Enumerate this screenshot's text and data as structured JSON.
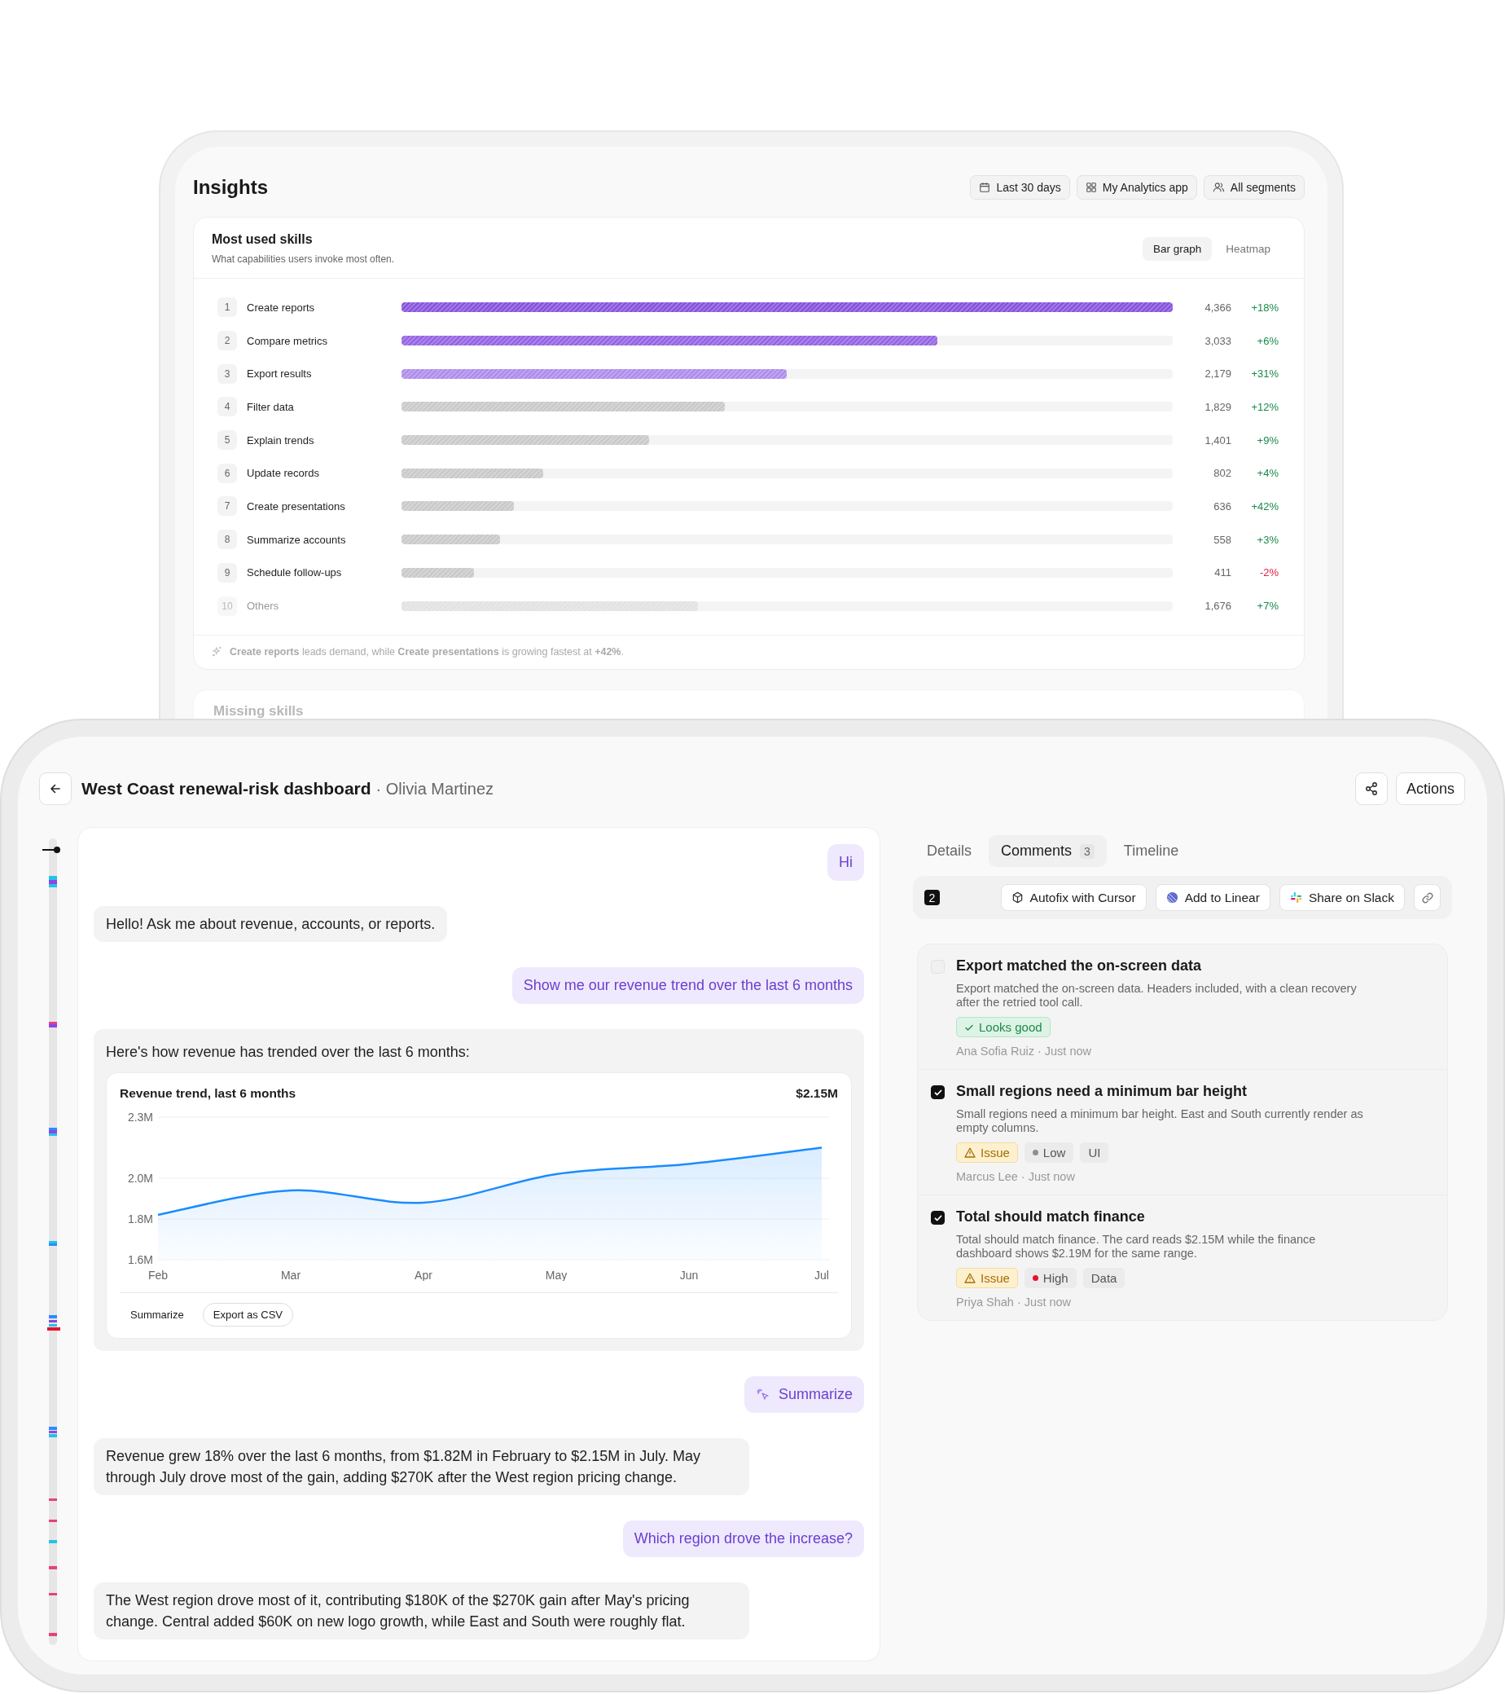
{
  "insights": {
    "title": "Insights",
    "filters": [
      {
        "kind": "date",
        "label": "Last 30 days"
      },
      {
        "kind": "app",
        "label": "My Analytics app"
      },
      {
        "kind": "segment",
        "label": "All segments"
      }
    ],
    "skills_card": {
      "title": "Most used skills",
      "subtitle": "What capabilities users invoke most often.",
      "views": [
        {
          "label": "Bar graph",
          "selected": true
        },
        {
          "label": "Heatmap",
          "selected": false
        }
      ],
      "rows": [
        {
          "rank": "1",
          "label": "Create reports",
          "level": 1.0,
          "color": "#8652dc",
          "count": "4,366",
          "change": {
            "text": "+18%",
            "color": "#1b8a4a"
          },
          "muted": false
        },
        {
          "rank": "2",
          "label": "Compare metrics",
          "level": 0.695,
          "color": "#9462e3",
          "count": "3,033",
          "change": {
            "text": "+6%",
            "color": "#1b8a4a"
          },
          "muted": false
        },
        {
          "rank": "3",
          "label": "Export results",
          "level": 0.499,
          "color": "#ae8bec",
          "count": "2,179",
          "change": {
            "text": "+31%",
            "color": "#1b8a4a"
          },
          "muted": false
        },
        {
          "rank": "4",
          "label": "Filter data",
          "level": 0.419,
          "color": "#c9c9c9",
          "count": "1,829",
          "change": {
            "text": "+12%",
            "color": "#1b8a4a"
          },
          "muted": false
        },
        {
          "rank": "5",
          "label": "Explain trends",
          "level": 0.321,
          "color": "#c9c9c9",
          "count": "1,401",
          "change": {
            "text": "+9%",
            "color": "#1b8a4a"
          },
          "muted": false
        },
        {
          "rank": "6",
          "label": "Update records",
          "level": 0.184,
          "color": "#c9c9c9",
          "count": "802",
          "change": {
            "text": "+4%",
            "color": "#1b8a4a"
          },
          "muted": false
        },
        {
          "rank": "7",
          "label": "Create presentations",
          "level": 0.146,
          "color": "#c9c9c9",
          "count": "636",
          "change": {
            "text": "+42%",
            "color": "#1b8a4a"
          },
          "muted": false
        },
        {
          "rank": "8",
          "label": "Summarize accounts",
          "level": 0.128,
          "color": "#c9c9c9",
          "count": "558",
          "change": {
            "text": "+3%",
            "color": "#1b8a4a"
          },
          "muted": false
        },
        {
          "rank": "9",
          "label": "Schedule follow-ups",
          "level": 0.094,
          "color": "#c9c9c9",
          "count": "411",
          "change": {
            "text": "-2%",
            "color": "#dd2244"
          },
          "muted": false
        },
        {
          "rank": "10",
          "label": "Others",
          "level": 0.384,
          "color": "#e2e2e2",
          "count": "1,676",
          "change": {
            "text": "+7%",
            "color": "#1b8a4a"
          },
          "muted": true
        }
      ],
      "footer": "**Create reports** leads demand, while **Create presentations** is growing fastest at **+42%**."
    },
    "next_card": {
      "title": "Missing skills"
    }
  },
  "detail": {
    "title": "West Coast renewal-risk dashboard",
    "subtitle": "· Olivia Martinez",
    "actions_button": "Actions",
    "chat": {
      "messages": [
        {
          "kind": "user",
          "text": "Hi"
        },
        {
          "kind": "assistant",
          "text": "Hello! Ask me about revenue, accounts, or reports."
        },
        {
          "kind": "user",
          "text": "Show me our revenue trend over the last 6 months"
        },
        {
          "kind": "assistant_chart",
          "text": "Here's how revenue has trended over the last 6 months:",
          "chart": {
            "total": "$2.15M",
            "chart_data": {
              "type": "area",
              "title": "Revenue trend, last 6 months",
              "categories": [
                "Feb",
                "Mar",
                "Apr",
                "May",
                "Jun",
                "Jul"
              ],
              "series": [
                {
                  "color": "#1a8cff",
                  "values": [
                    1.82,
                    1.94,
                    1.88,
                    2.02,
                    2.07,
                    2.15
                  ]
                }
              ],
              "ylim": [
                1.6,
                2.3
              ],
              "yticks": [
                {
                  "value": 2.3,
                  "label": "2.3M"
                },
                {
                  "value": 2.0,
                  "label": "2.0M"
                },
                {
                  "value": 1.8,
                  "label": "1.8M"
                },
                {
                  "value": 1.6,
                  "label": "1.6M"
                }
              ]
            },
            "actions": [
              {
                "kind": "ghost",
                "label": "Summarize"
              },
              {
                "kind": "outline",
                "label": "Export as CSV"
              }
            ]
          }
        },
        {
          "kind": "user_action",
          "text": "Summarize"
        },
        {
          "kind": "assistant",
          "text": "Revenue grew 18% over the last 6 months, from $1.82M in February to $2.15M in July. May through July drove most of the gain, adding $270K after the West region pricing change."
        },
        {
          "kind": "user",
          "text": "Which region drove the increase?"
        },
        {
          "kind": "assistant",
          "text": "The West region drove most of it, contributing $180K of the $270K gain after May's pricing change. Central added $60K on new logo growth, while East and South were roughly flat."
        }
      ]
    },
    "side": {
      "tabs": [
        {
          "label": "Details",
          "selected": false
        },
        {
          "label": "Comments",
          "count": "3",
          "selected": true
        },
        {
          "label": "Timeline",
          "selected": false
        }
      ],
      "toolbar": {
        "count": "2",
        "buttons": [
          {
            "kind": "cursor",
            "label": "Autofix with Cursor"
          },
          {
            "kind": "linear",
            "label": "Add to Linear"
          },
          {
            "kind": "slack",
            "label": "Share on Slack"
          },
          {
            "kind": "link"
          }
        ]
      },
      "comments": [
        {
          "checked": false,
          "title": "Export matched the on-screen data",
          "body": "Export matched the on-screen data. Headers included, with a clean recovery after the retried tool call.",
          "tags": [
            {
              "kind": "success",
              "label": "Looks good"
            }
          ],
          "meta": "Ana Sofia Ruiz · Just now"
        },
        {
          "checked": true,
          "title": "Small regions need a minimum bar height",
          "body": "Small regions need a minimum bar height. East and South currently render as empty columns.",
          "tags": [
            {
              "kind": "issue",
              "label": "Issue"
            },
            {
              "kind": "priority",
              "label": "Low",
              "color": "#8e8e8e"
            },
            {
              "kind": "plain",
              "label": "UI"
            }
          ],
          "meta": "Marcus Lee · Just now"
        },
        {
          "checked": true,
          "title": "Total should match finance",
          "body": "Total should match finance. The card reads $2.15M while the finance dashboard shows $2.19M for the same range.",
          "tags": [
            {
              "kind": "issue",
              "label": "Issue"
            },
            {
              "kind": "priority",
              "label": "High",
              "color": "#e8102e"
            },
            {
              "kind": "plain",
              "label": "Data"
            }
          ],
          "meta": "Priya Shah · Just now"
        }
      ]
    }
  }
}
